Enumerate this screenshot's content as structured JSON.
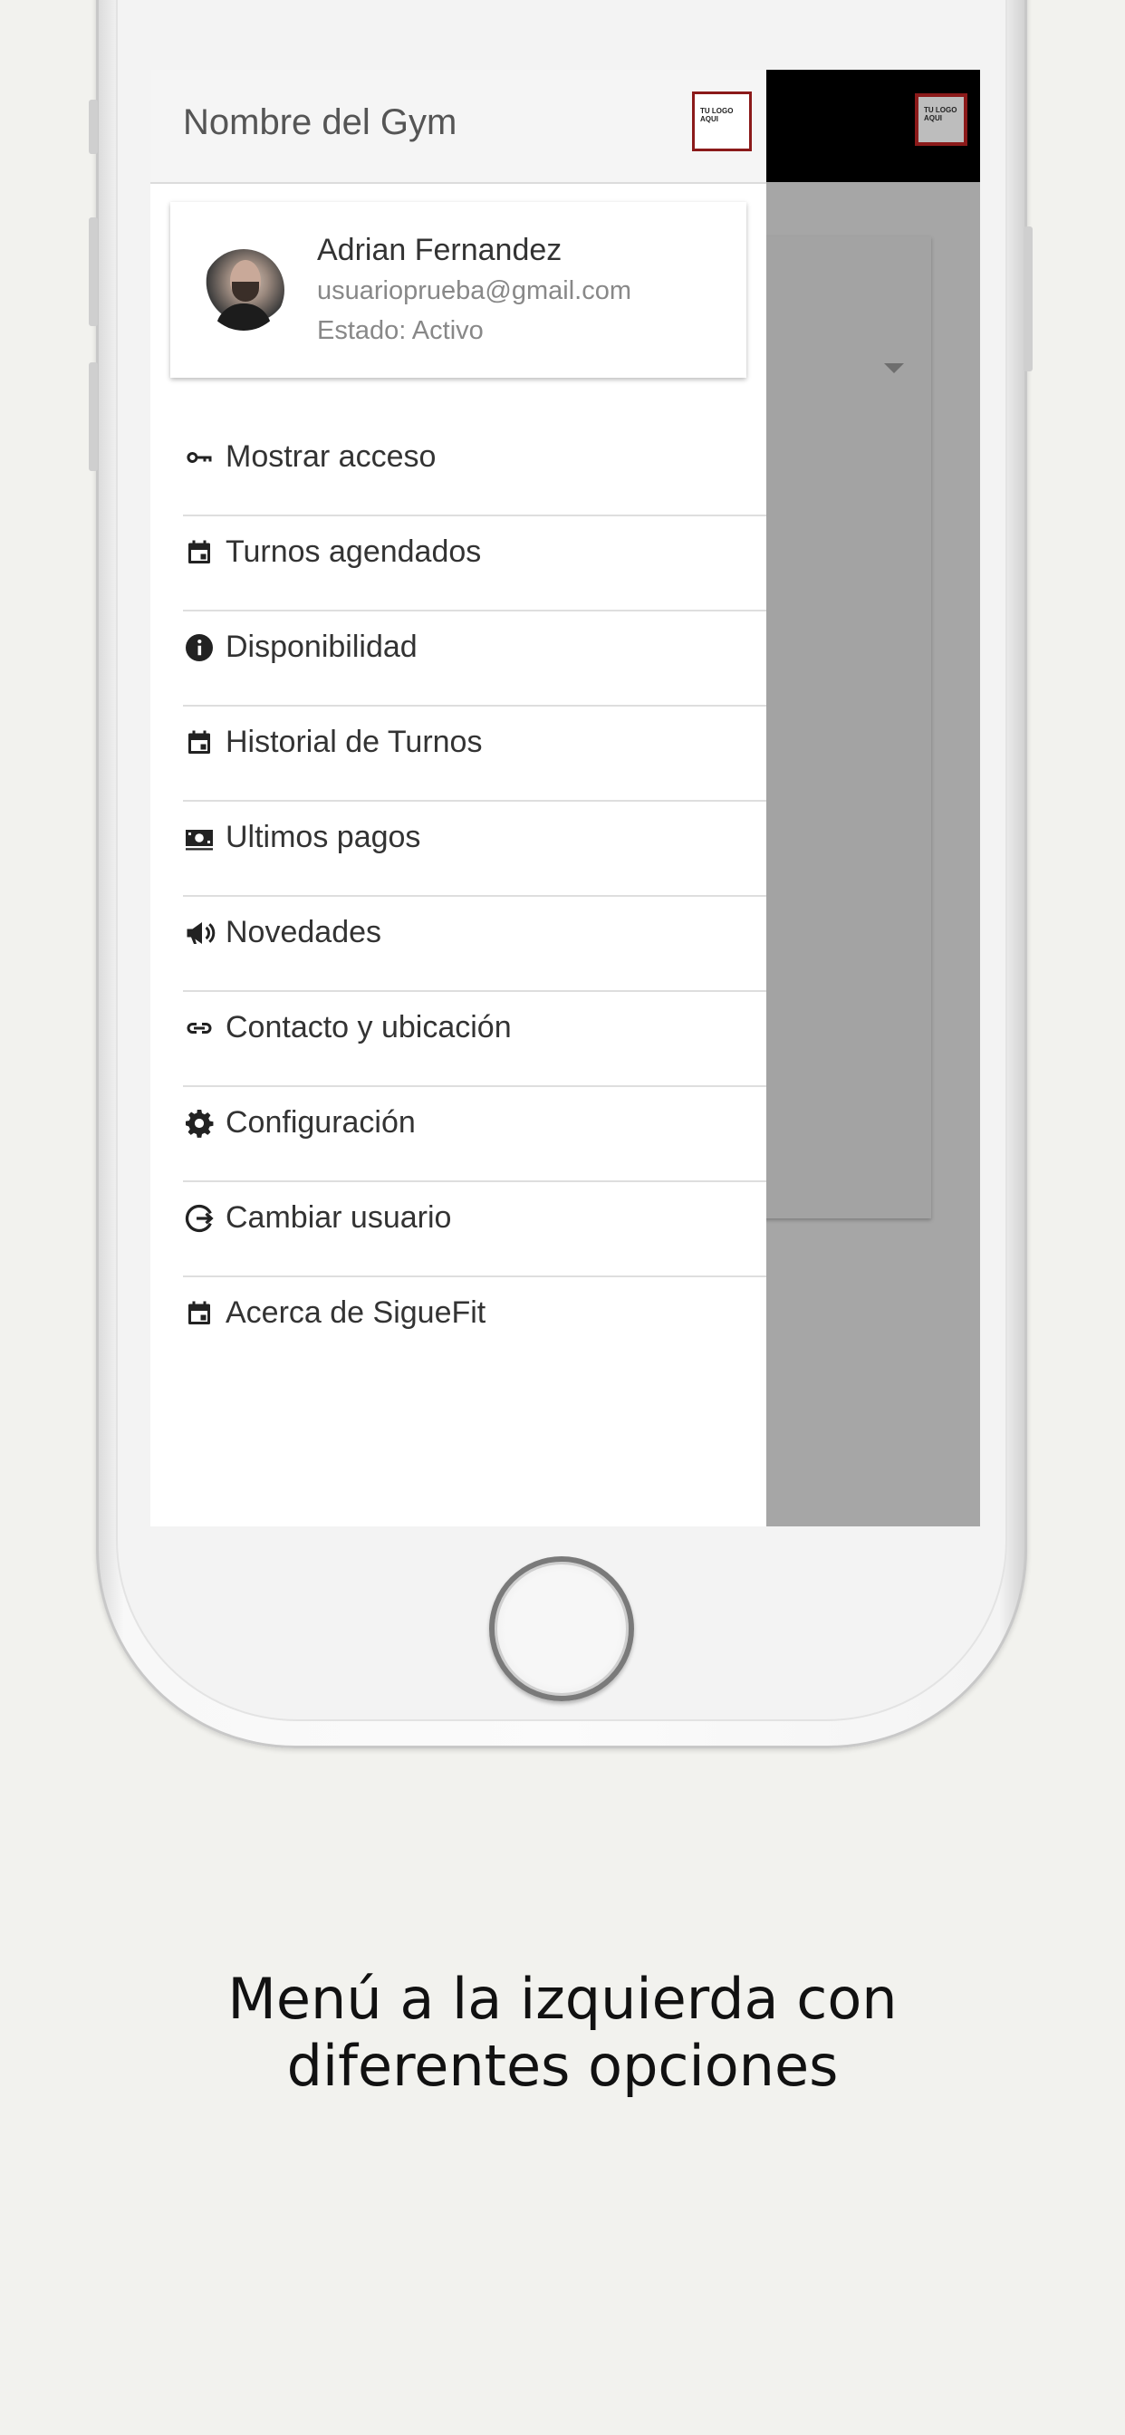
{
  "drawer": {
    "title": "Nombre del Gym",
    "logo_text": "TU LOGO AQUI",
    "user": {
      "name": "Adrian Fernandez",
      "email": "usuarioprueba@gmail.com",
      "status": "Estado: Activo"
    },
    "items": [
      {
        "label": "Mostrar acceso",
        "icon": "key-icon"
      },
      {
        "label": "Turnos agendados",
        "icon": "calendar-icon"
      },
      {
        "label": "Disponibilidad",
        "icon": "info-icon"
      },
      {
        "label": "Historial de Turnos",
        "icon": "calendar-icon"
      },
      {
        "label": "Ultimos pagos",
        "icon": "money-icon"
      },
      {
        "label": "Novedades",
        "icon": "megaphone-icon"
      },
      {
        "label": "Contacto y ubicación",
        "icon": "link-icon"
      },
      {
        "label": "Configuración",
        "icon": "gear-icon"
      },
      {
        "label": "Cambiar usuario",
        "icon": "logout-icon"
      },
      {
        "label": "Acerca de SigueFit",
        "icon": "calendar-icon"
      }
    ]
  },
  "app": {
    "logo_text": "TU LOGO AQUI"
  },
  "caption": {
    "line1": "Menú a la izquierda con",
    "line2": "diferentes opciones"
  }
}
